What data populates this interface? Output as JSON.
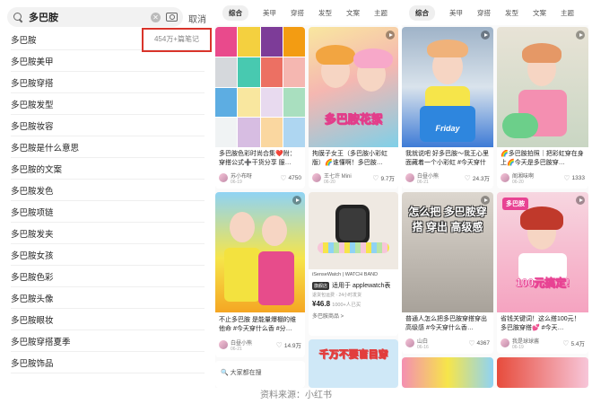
{
  "search": {
    "query": "多巴胺",
    "cancel_label": "取消"
  },
  "suggestions": [
    {
      "text": "多巴胺",
      "count": "454万+篇笔记"
    },
    {
      "text": "多巴胺美甲"
    },
    {
      "text": "多巴胺穿搭"
    },
    {
      "text": "多巴胺发型"
    },
    {
      "text": "多巴胺妆容"
    },
    {
      "text": "多巴胺是什么意思"
    },
    {
      "text": "多巴胺的文案"
    },
    {
      "text": "多巴胺发色"
    },
    {
      "text": "多巴胺项链"
    },
    {
      "text": "多巴胺发夹"
    },
    {
      "text": "多巴胺女孩"
    },
    {
      "text": "多巴胺色彩"
    },
    {
      "text": "多巴胺头像"
    },
    {
      "text": "多巴胺眼妆"
    },
    {
      "text": "多巴胺穿搭夏季"
    },
    {
      "text": "多巴胺饰品"
    }
  ],
  "tabs": [
    "综合",
    "美甲",
    "穿搭",
    "发型",
    "文案",
    "主题"
  ],
  "mid_cards": [
    {
      "title": "多巴胺色彩时尚合集❤️附：穿搭公式➕干货分享 服…",
      "author": "苏小布呀",
      "date": "06-19",
      "likes": "4750"
    },
    {
      "title": "拘膜子女王（多巴胺小彩虹版）🌈谁懂啊！多巴胺…",
      "author": "王七许 Mini",
      "date": "06-20",
      "likes": "9.7万",
      "overlay": "多巴胺花絮"
    },
    {
      "title": "不止多巴胺 是能量爆棚的维他命 #今天穿什么香 #分…",
      "author": "白昼小熊",
      "date": "06-21",
      "likes": "14.9万"
    },
    {
      "title": "适用于 applewatch表",
      "brand": "iSenseWatch",
      "brand_sub": "WATCH BAND",
      "tag": "旗舰店",
      "ship": "退货包运费 · 24小时发货",
      "price": "¥46.8",
      "buyers": "1000+人已买",
      "shop": "多巴胺商品 >"
    }
  ],
  "mid_bottom": {
    "hint": "大家都在搜",
    "overlay": "千万不要盲目穿"
  },
  "right_cards": [
    {
      "title": "我就说吧 好多巴胺～我王心里面藏着一个小彩虹 #今天穿什么香…",
      "author": "白昼小熊",
      "date": "06-21",
      "likes": "24.3万",
      "overlay": "Friday"
    },
    {
      "title": "🌈多巴胺拍照｜把彩虹穿在身上🌈今天是多巴胺穿…",
      "author": "阁湘味啊",
      "date": "06-20",
      "likes": "1333"
    },
    {
      "title": "普通人怎么把多巴胺穿搭穿出高级感 #今天穿什么香…",
      "author": "山白",
      "date": "06-16",
      "likes": "4367",
      "overlay": "怎么把 多巴胺穿搭 穿出 高级感"
    },
    {
      "title": "省钱关键词！这么搭100元！多巴胺穿搭💕 #今天…",
      "author": "我是球球酱",
      "date": "06-19",
      "likes": "5.4万",
      "overlay": "100元搞定!",
      "badge": "多巴胺"
    }
  ],
  "source_label": "资料来源：小红书",
  "colors": {
    "highlight": "#d9342b",
    "pink": "#f27ab0",
    "yellow": "#f6e54a"
  }
}
